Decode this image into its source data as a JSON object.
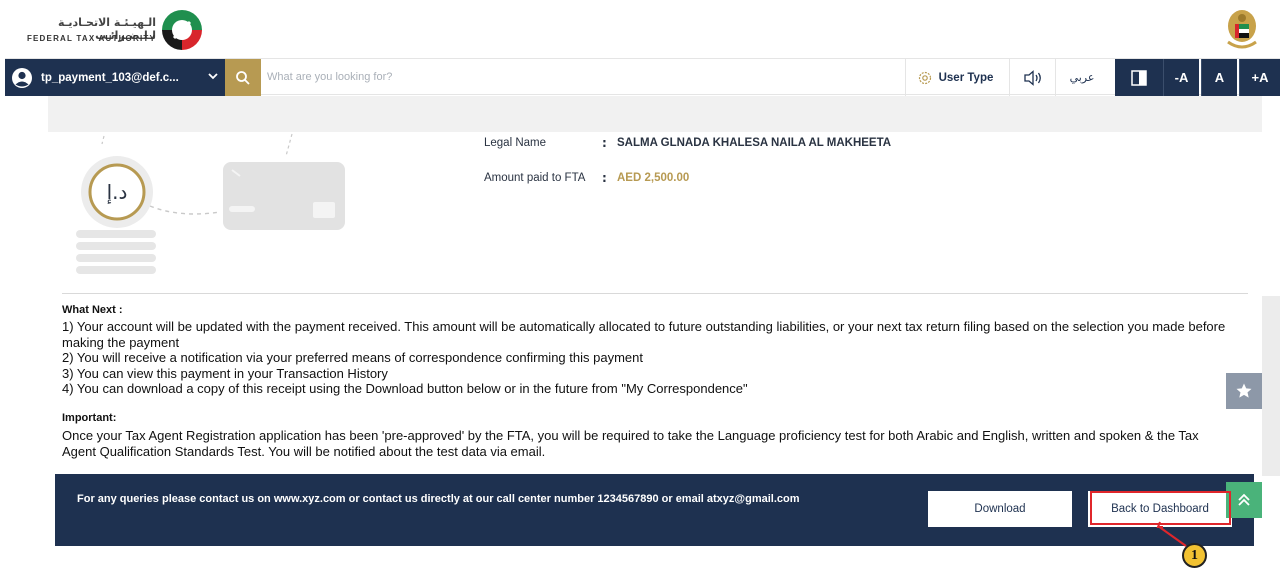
{
  "header": {
    "logo_ar": "الـهيـئـة الاتحـاديـة لـلـضـرائـب",
    "logo_en": "FEDERAL TAX AUTHORITY",
    "logo_icon": "fta-logo-icon",
    "emblem_icon": "uae-emblem-icon"
  },
  "navbar": {
    "username": "tp_payment_103@def.c...",
    "search_placeholder": "What are you looking for?",
    "user_type_label": "User Type",
    "language_label": "عربي",
    "font_decrease": "-A",
    "font_normal": "A",
    "font_increase": "+A"
  },
  "details": {
    "legal_name_label": "Legal Name",
    "legal_name_value": "SALMA GLNADA KHALESA NAILA AL MAKHEETA",
    "amount_label": "Amount paid to FTA",
    "amount_value": "AED 2,500.00",
    "colon": ":",
    "currency_symbol": "د.إ"
  },
  "what_next": {
    "heading": "What Next :",
    "items": [
      "1) Your account will be updated with the payment received. This amount will be automatically allocated to future outstanding liabilities, or your next tax return filing based on the selection you made before making the payment",
      "2) You will receive a notification via your preferred means of correspondence confirming this payment",
      "3) You can view this payment in your Transaction History",
      "4) You can download a copy of this receipt using the Download button below or in the future from \"My Correspondence\""
    ]
  },
  "important": {
    "heading": "Important:",
    "text": "Once your Tax Agent Registration application has been 'pre-approved' by the FTA, you will be required to take the Language proficiency test for both Arabic and English, written and spoken & the Tax Agent Qualification Standards Test. You will be notified about the test data via email."
  },
  "footer": {
    "contact_text": "For any queries please contact us on www.xyz.com or contact us directly at our call center number 1234567890 or email atxyz@gmail.com",
    "download_label": "Download",
    "dashboard_label": "Back to Dashboard"
  },
  "annotation": {
    "callout_number": "1",
    "highlight_color": "#e0262b"
  },
  "colors": {
    "navy": "#1e3150",
    "gold": "#b79a52",
    "green": "#4ab37a"
  }
}
